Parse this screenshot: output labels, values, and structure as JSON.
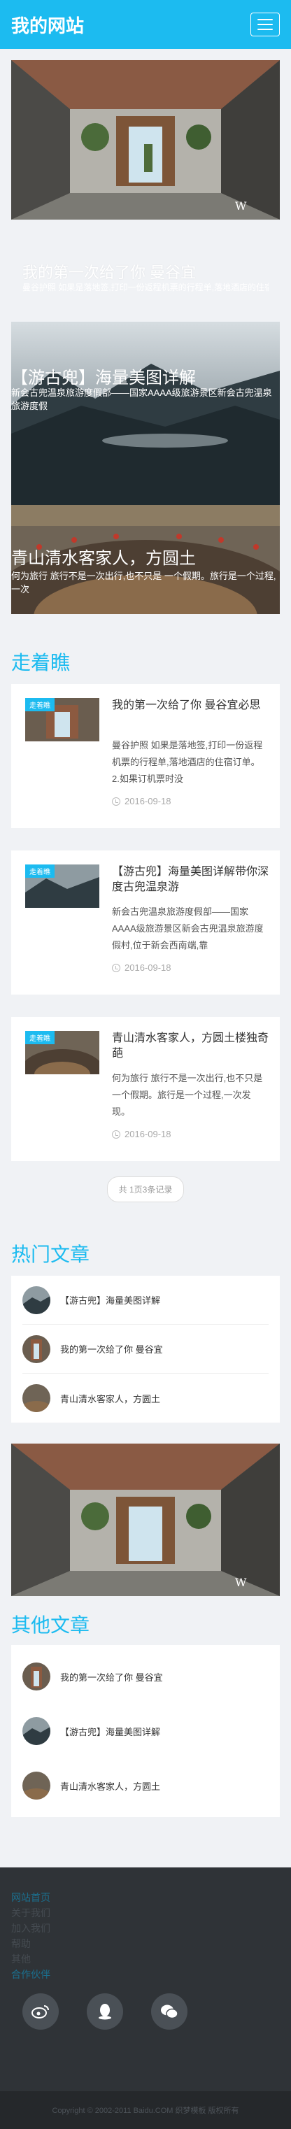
{
  "header": {
    "site_title": "我的网站",
    "menu_icon": "hamburger-icon"
  },
  "slides": [
    {
      "title": "我的第一次给了你 曼谷宜",
      "desc": "曼谷护照 如果是落地签,打印一份返程机票的行程单,落地酒店的住宿订单。2.如果订机票时..."
    },
    {
      "title": "【游古兜】海量美图详解",
      "desc": "新会古兜温泉旅游度假部——国家AAAA级旅游景区新会古兜温泉旅游度假"
    },
    {
      "title": "青山清水客家人，方圆土",
      "desc": "何为旅行 旅行不是一次出行,也不只是 一个假期。旅行是一个过程,一次"
    }
  ],
  "section_latest": {
    "heading": "走着瞧"
  },
  "articles": [
    {
      "tag": "走着瞧",
      "title": "我的第一次给了你 曼谷宜必思",
      "excerpt": "曼谷护照 如果是落地签,打印一份返程机票的行程单,落地酒店的住宿订单。 2.如果订机票时没",
      "date": "2016-09-18"
    },
    {
      "tag": "走着瞧",
      "title": "【游古兜】海量美图详解带你深度古兜温泉游",
      "excerpt": "新会古兜温泉旅游度假部——国家AAAA级旅游景区新会古兜温泉旅游度假村,位于新会西南端,靠",
      "date": "2016-09-18"
    },
    {
      "tag": "走着瞧",
      "title": "青山清水客家人，方圆土楼独奇葩",
      "excerpt": "何为旅行 旅行不是一次出行,也不只是 一个假期。旅行是一个过程,一次发现。",
      "date": "2016-09-18"
    }
  ],
  "pager": {
    "text": "共 1页3条记录"
  },
  "section_hot": {
    "heading": "热门文章"
  },
  "hot_list": [
    {
      "title": "【游古兜】海量美图详解"
    },
    {
      "title": "我的第一次给了你 曼谷宜"
    },
    {
      "title": "青山清水客家人，方圆土"
    }
  ],
  "section_other": {
    "heading": "其他文章"
  },
  "other_list": [
    {
      "title": "我的第一次给了你 曼谷宜"
    },
    {
      "title": "【游古兜】海量美图详解"
    },
    {
      "title": "青山清水客家人，方圆土"
    }
  ],
  "footer": {
    "links": [
      {
        "label": "网站首页"
      },
      {
        "label": "关于我们"
      },
      {
        "label": "加入我们"
      },
      {
        "label": "帮助"
      },
      {
        "label": "其他"
      },
      {
        "label": "合作伙伴"
      }
    ],
    "socials": [
      "weibo-icon",
      "qq-icon",
      "wechat-icon"
    ],
    "copyright": "Copyright © 2002-2011 Baidu.COM 织梦模板 版权所有"
  },
  "colors": {
    "accent": "#1cbbf0",
    "footer_bg": "#2f3337"
  }
}
